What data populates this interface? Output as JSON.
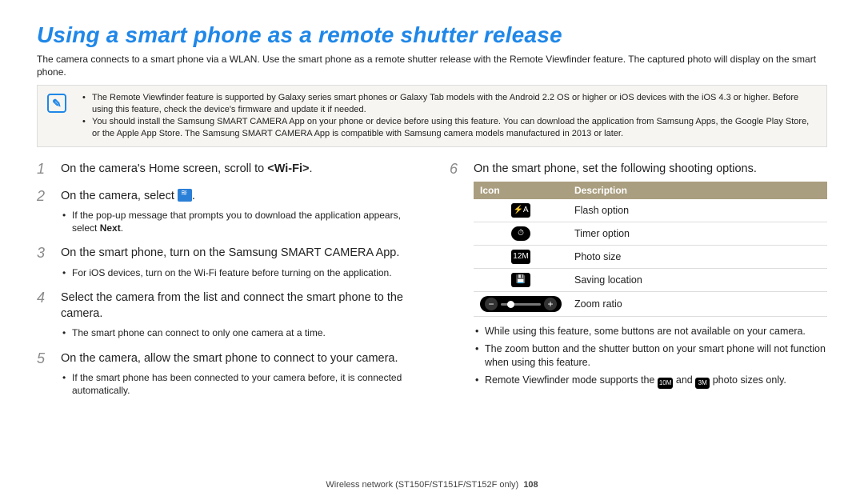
{
  "title": "Using a smart phone as a remote shutter release",
  "intro": "The camera connects to a smart phone via a WLAN. Use the smart phone as a remote shutter release with the Remote Viewfinder feature. The captured photo will display on the smart phone.",
  "notebox": {
    "icon_name": "note-icon",
    "icon_glyph": "✎",
    "items": [
      "The Remote Viewfinder feature is supported by Galaxy series smart phones or Galaxy Tab models with the Android 2.2 OS or higher or iOS devices with the iOS 4.3 or higher. Before using this feature, check the device's firmware and update it if needed.",
      "You should install the Samsung SMART CAMERA App on your phone or device before using this feature. You can download the application from Samsung Apps, the Google Play Store, or the Apple App Store. The Samsung SMART CAMERA App is compatible with Samsung camera models manufactured in 2013 or later."
    ]
  },
  "steps_left": [
    {
      "num": "1",
      "main_pre": "On the camera's Home screen, scroll to ",
      "main_bold": "<Wi-Fi>",
      "main_post": ".",
      "sub": []
    },
    {
      "num": "2",
      "main_pre": "On the camera, select ",
      "inline_icon": true,
      "main_post": ".",
      "sub": [
        {
          "pre": "If the pop-up message that prompts you to download the application appears, select ",
          "bold": "Next",
          "post": "."
        }
      ]
    },
    {
      "num": "3",
      "main_pre": "On the smart phone, turn on the Samsung SMART CAMERA App.",
      "sub": [
        {
          "pre": "For iOS devices, turn on the Wi-Fi feature before turning on the application."
        }
      ]
    },
    {
      "num": "4",
      "main_pre": "Select the camera from the list and connect the smart phone to the camera.",
      "sub": [
        {
          "pre": "The smart phone can connect to only one camera at a time."
        }
      ]
    },
    {
      "num": "5",
      "main_pre": "On the camera, allow the smart phone to connect to your camera.",
      "sub": [
        {
          "pre": "If the smart phone has been connected to your camera before, it is connected automatically."
        }
      ]
    }
  ],
  "step6": {
    "num": "6",
    "main": "On the smart phone, set the following shooting options."
  },
  "table": {
    "head_icon": "Icon",
    "head_desc": "Description",
    "rows": [
      {
        "icon_glyph": "⚡A",
        "icon_name": "flash-auto-icon",
        "desc": "Flash option"
      },
      {
        "icon_glyph": "⏱",
        "icon_name": "timer-icon",
        "desc": "Timer option"
      },
      {
        "icon_glyph": "12M",
        "icon_name": "photo-size-12m-icon",
        "desc": "Photo size"
      },
      {
        "icon_glyph": "💾",
        "icon_name": "save-location-icon",
        "desc": "Saving location"
      },
      {
        "zoom": true,
        "icon_name": "zoom-slider-icon",
        "desc": "Zoom ratio"
      }
    ]
  },
  "after_notes": {
    "n1": "While using this feature, some buttons are not available on your camera.",
    "n2": "The zoom button and the shutter button on your smart phone will not function when using this feature.",
    "n3_pre": "Remote Viewfinder mode supports the ",
    "n3_icon_a": "10M",
    "n3_mid": " and ",
    "n3_icon_b": "3M",
    "n3_post": " photo sizes only."
  },
  "footer": {
    "text": "Wireless network  (ST150F/ST151F/ST152F only)",
    "page": "108"
  }
}
